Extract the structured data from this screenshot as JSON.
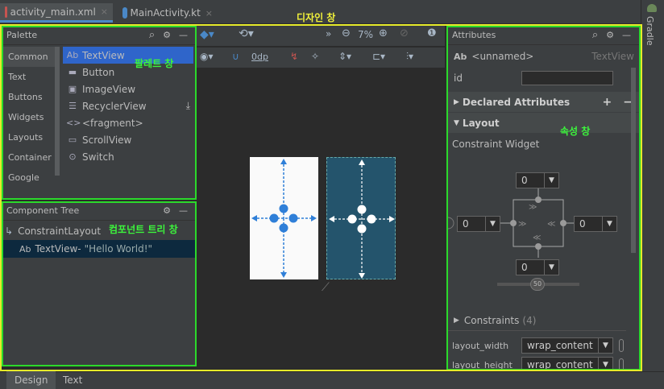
{
  "tabs": [
    {
      "label": "activity_main.xml",
      "close": "×"
    },
    {
      "label": "MainActivity.kt",
      "close": "×"
    }
  ],
  "side_tool": "Gradle",
  "annotations": {
    "design": "디자인 창",
    "palette": "팔레트 창",
    "tree": "컴포넌트 트리 창",
    "attributes": "속성 창"
  },
  "palette": {
    "title": "Palette",
    "categories": [
      "Common",
      "Text",
      "Buttons",
      "Widgets",
      "Layouts",
      "Container",
      "Google"
    ],
    "items": [
      {
        "icon": "Ab",
        "label": "TextView"
      },
      {
        "icon": "▬",
        "label": "Button"
      },
      {
        "icon": "▣",
        "label": "ImageView"
      },
      {
        "icon": "☰",
        "label": "RecyclerView"
      },
      {
        "icon": "<>",
        "label": "<fragment>"
      },
      {
        "icon": "▭",
        "label": "ScrollView"
      },
      {
        "icon": "⊙",
        "label": "Switch"
      }
    ]
  },
  "tree": {
    "title": "Component Tree",
    "root": "ConstraintLayout",
    "child_icon": "Ab",
    "child": "TextView-",
    "child_text": "\"Hello World!\""
  },
  "toolbar": {
    "zoom": "7%",
    "margin": "0dp",
    "chevrons": "»"
  },
  "attributes": {
    "title": "Attributes",
    "id_type": "Ab",
    "name": "<unnamed>",
    "type": "TextView",
    "id_label": "id",
    "id_value": "",
    "declared": "Declared Attributes",
    "layout": "Layout",
    "widget": "Constraint Widget",
    "top": "0",
    "left": "0",
    "right": "0",
    "bottom": "0",
    "bias": "50",
    "constraints": "Constraints",
    "constraints_count": "(4)",
    "layout_width_label": "layout_width",
    "layout_width": "wrap_content",
    "layout_height_label": "layout_height",
    "layout_height": "wrap_content"
  },
  "bottom_tabs": [
    "Design",
    "Text"
  ]
}
